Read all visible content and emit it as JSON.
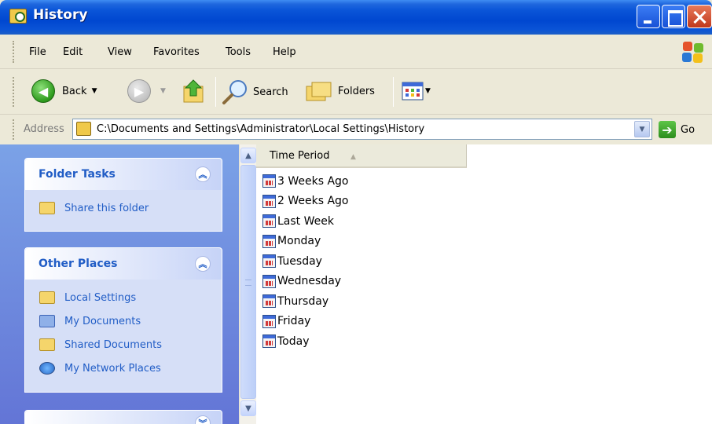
{
  "window": {
    "title": "History"
  },
  "menu": {
    "items": [
      "File",
      "Edit",
      "View",
      "Favorites",
      "Tools",
      "Help"
    ]
  },
  "toolbar": {
    "back_label": "Back",
    "search_label": "Search",
    "folders_label": "Folders"
  },
  "address": {
    "label": "Address",
    "path": "C:\\Documents and Settings\\Administrator\\Local Settings\\History",
    "go_label": "Go"
  },
  "taskpane": {
    "folder_tasks": {
      "title": "Folder Tasks",
      "items": [
        "Share this folder"
      ]
    },
    "other_places": {
      "title": "Other Places",
      "items": [
        "Local Settings",
        "My Documents",
        "Shared Documents",
        "My Network Places"
      ]
    }
  },
  "list": {
    "column_header": "Time Period",
    "items": [
      "3 Weeks Ago",
      "2 Weeks Ago",
      "Last Week",
      "Monday",
      "Tuesday",
      "Wednesday",
      "Thursday",
      "Friday",
      "Today"
    ]
  },
  "colors": {
    "titlebar": "#0a55d8",
    "taskpane_bg": "#6f8fe0",
    "link": "#215dc6"
  }
}
